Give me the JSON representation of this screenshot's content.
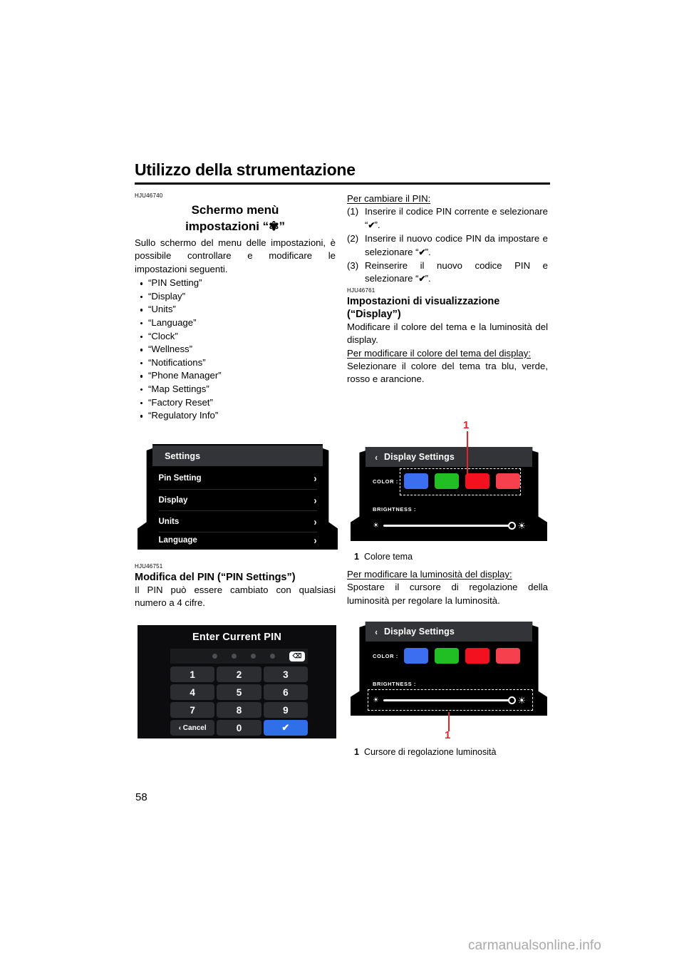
{
  "header": {
    "chapter_title": "Utilizzo della strumentazione"
  },
  "left_column": {
    "ref_id": "HJU46740",
    "section_title_line1": "Schermo menù",
    "section_title_line2": "impostazioni “☀”",
    "intro": "Sullo schermo del menu delle impostazioni, è possibile controllare e modificare le impostazioni seguenti.",
    "bullets": [
      "“PIN Setting”",
      "“Display”",
      "“Units”",
      "“Language”",
      "“Clock”",
      "“Wellness”",
      "“Notifications”",
      "“Phone Manager”",
      "“Map Settings”",
      "“Factory Reset”",
      "“Regulatory Info”"
    ],
    "pin_section": {
      "ref_id": "HJU46751",
      "title": "Modifica del PIN (“PIN Settings”)",
      "body": "Il PIN può essere cambiato con qualsiasi numero a 4 cifre."
    }
  },
  "right_column": {
    "change_pin_heading": "Per cambiare il PIN:",
    "steps": [
      {
        "num": "(1)",
        "text_before": "Inserire il codice PIN corrente e selezionare “",
        "text_after": "”."
      },
      {
        "num": "(2)",
        "text_before": "Inserire il nuovo codice PIN da impostare e selezionare “",
        "text_after": "”."
      },
      {
        "num": "(3)",
        "text_before": "Reinserire il nuovo codice PIN e selezionare “",
        "text_after": "”."
      }
    ],
    "check_glyph": "✔",
    "display_section": {
      "ref_id": "HJU46761",
      "title_line1": "Impostazioni di visualizzazione",
      "title_line2": "(“Display”)",
      "body": "Modificare il colore del tema e la luminosità del display.",
      "theme_heading": "Per modificare il colore del tema del display:",
      "theme_body": "Selezionare il colore del tema tra blu, verde, rosso e arancione.",
      "brightness_heading": "Per modificare la luminosità del display:",
      "brightness_body": "Spostare il cursore di regolazione della luminosità per regolare la luminosità."
    }
  },
  "settings_screen": {
    "title": "Settings",
    "rows": [
      {
        "label": "Pin Setting",
        "chevron": "›"
      },
      {
        "label": "Display",
        "chevron": "›"
      },
      {
        "label": "Units",
        "chevron": "›"
      },
      {
        "label": "Language",
        "chevron": "›"
      }
    ]
  },
  "pin_screen": {
    "title": "Enter Current PIN",
    "dots": 4,
    "backspace_glyph": "⌫",
    "keys": [
      "1",
      "2",
      "3",
      "4",
      "5",
      "6",
      "7",
      "8",
      "9"
    ],
    "cancel_label": "‹ Cancel",
    "zero_label": "0",
    "confirm_glyph": "✔"
  },
  "display_screen": {
    "title": "Display Settings",
    "back_glyph": "‹",
    "color_label": "COLOR :",
    "brightness_label": "BRIGHTNESS :",
    "swatch_colors": [
      "#3c6ef0",
      "#22bf24",
      "#f3111f",
      "#f7404e"
    ],
    "low_brightness_icon": "☀",
    "high_brightness_icon": "☀",
    "knob_position_percent": 93
  },
  "callouts": {
    "theme_color": {
      "number": "1",
      "legend": "Colore tema"
    },
    "brightness_slider": {
      "number": "1",
      "legend": "Cursore di regolazione luminosità"
    }
  },
  "footer": {
    "page_number": "58",
    "watermark": "carmanualsonline.info"
  }
}
